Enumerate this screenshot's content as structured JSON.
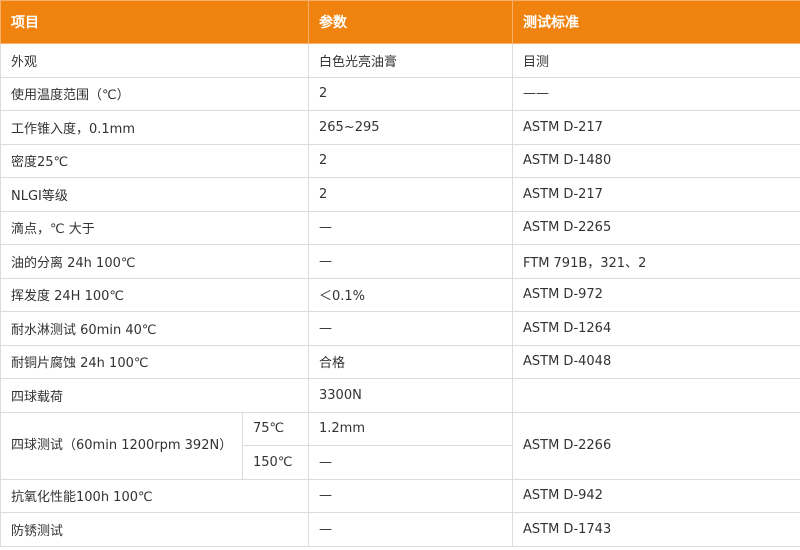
{
  "table": {
    "headers": {
      "item": "项目",
      "param": "参数",
      "standard": "测试标准"
    },
    "rows": [
      {
        "item": "外观",
        "param": "白色光亮油膏",
        "standard": "目测"
      },
      {
        "item": "使用温度范围（℃）",
        "param": "2",
        "standard": "——"
      },
      {
        "item": "工作锥入度，0.1mm",
        "param": "265~295",
        "standard": "ASTM D-217"
      },
      {
        "item": "密度25℃",
        "param": "2",
        "standard": "ASTM D-1480"
      },
      {
        "item": "NLGI等级",
        "param": "2",
        "standard": "ASTM D-217"
      },
      {
        "item": "滴点，℃ 大于",
        "param": "—",
        "standard": "ASTM D-2265"
      },
      {
        "item": "油的分离 24h 100℃",
        "param": "—",
        "standard": "FTM 791B，321、2"
      },
      {
        "item": "挥发度 24H 100℃",
        "param": "＜0.1%",
        "standard": "ASTM D-972"
      },
      {
        "item": "耐水淋测试 60min 40℃",
        "param": "—",
        "standard": "ASTM D-1264"
      },
      {
        "item": "耐铜片腐蚀 24h 100℃",
        "param": "合格",
        "standard": "ASTM D-4048"
      },
      {
        "item": "四球载荷",
        "param": "3300N",
        "standard": ""
      }
    ],
    "four_ball_test": {
      "item": "四球测试（60min 1200rpm 392N）",
      "standard": "ASTM D-2266",
      "sub": [
        {
          "temp": "75℃",
          "param": "1.2mm"
        },
        {
          "temp": "150℃",
          "param": "—"
        }
      ]
    },
    "rows_after": [
      {
        "item": "抗氧化性能100h 100℃",
        "param": "—",
        "standard": "ASTM D-942"
      },
      {
        "item": "防锈测试",
        "param": "—",
        "standard": "ASTM D-1743"
      }
    ]
  }
}
